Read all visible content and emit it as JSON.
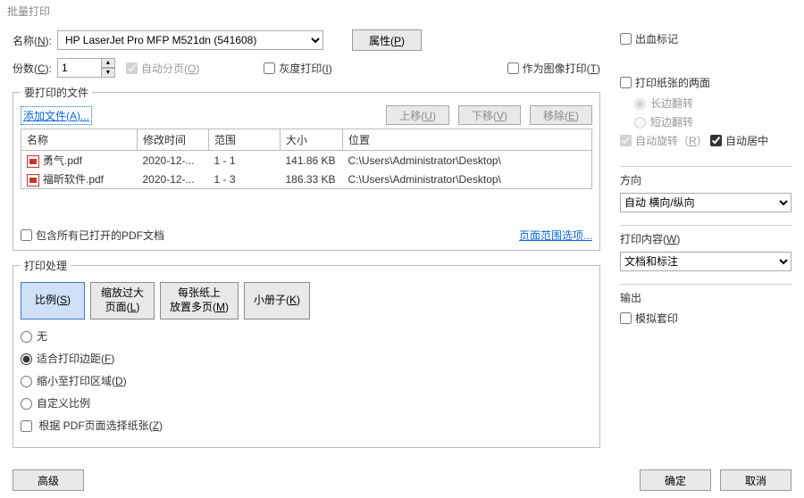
{
  "window_title": "批量打印",
  "printer": {
    "name_label": "名称(N):",
    "props_label": "属性(P)",
    "selected": "HP LaserJet Pro MFP M521dn (541608)"
  },
  "copies": {
    "label": "份数(C):",
    "value": "1",
    "collate": "自动分页(O)"
  },
  "toprow": {
    "gray": "灰度打印(I)",
    "as_image": "作为图像打印(T)",
    "bleed": "出血标记"
  },
  "files_section": {
    "legend": "要打印的文件",
    "add": "添加文件(A)...",
    "up": "上移(U)",
    "down": "下移(V)",
    "remove": "移除(E)",
    "headers": {
      "name": "名称",
      "mod": "修改时间",
      "range": "范围",
      "size": "大小",
      "loc": "位置"
    },
    "rows": [
      {
        "name": "勇气.pdf",
        "mod": "2020-12-...",
        "range": "1 - 1",
        "size": "141.86 KB",
        "loc": "C:\\Users\\Administrator\\Desktop\\"
      },
      {
        "name": "福昕软件.pdf",
        "mod": "2020-12-...",
        "range": "1 - 3",
        "size": "186.33 KB",
        "loc": "C:\\Users\\Administrator\\Desktop\\"
      }
    ],
    "include_open": "包含所有已打开的PDF文档",
    "range_options": "页面范围选项..."
  },
  "handling": {
    "legend": "打印处理",
    "scale": "比例(S)",
    "big": "缩放过大\n页面(L)",
    "multi": "每张纸上\n放置多页(M)",
    "booklet": "小册子(K)",
    "r_none": "无",
    "r_fit": "适合打印边距(F)",
    "r_shrink": "缩小至打印区域(D)",
    "r_custom": "自定义比例",
    "pdf_page_select": "根据 PDF页面选择纸张(Z)"
  },
  "paper": {
    "both_sides": "打印纸张的两面",
    "long_edge": "长边翻转",
    "short_edge": "短边翻转",
    "auto_rotate": "自动旋转（R）",
    "auto_center": "自动居中"
  },
  "orientation": {
    "label": "方向",
    "value": "自动 横向/纵向"
  },
  "content": {
    "label": "打印内容(W)",
    "value": "文档和标注"
  },
  "output": {
    "label": "输出",
    "simulate": "模拟套印"
  },
  "buttons": {
    "adv": "高级",
    "ok": "确定",
    "cancel": "取消"
  }
}
